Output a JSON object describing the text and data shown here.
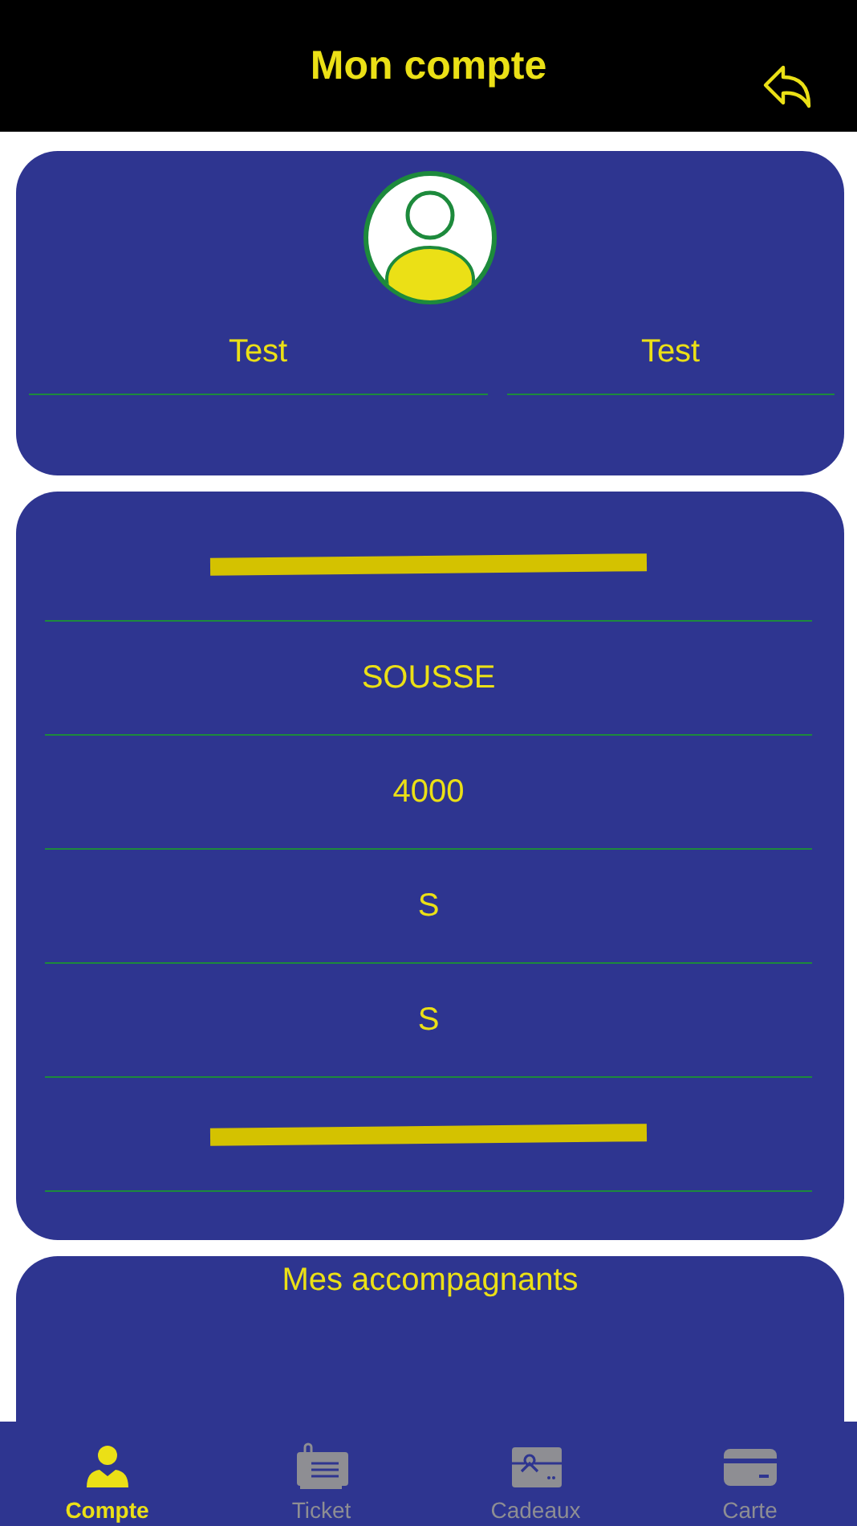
{
  "header": {
    "title": "Mon compte"
  },
  "profile": {
    "names": [
      {
        "value": "Test"
      },
      {
        "value": "Test"
      }
    ]
  },
  "details": [
    {
      "redacted": true
    },
    {
      "value": "SOUSSE",
      "redacted": false
    },
    {
      "value": "4000",
      "redacted": false
    },
    {
      "value": "S",
      "redacted": false
    },
    {
      "value": "S",
      "redacted": false
    },
    {
      "redacted": true
    }
  ],
  "companions": {
    "title": "Mes accompagnants"
  },
  "tabs": [
    {
      "label": "Compte",
      "kind": "user",
      "selected": true
    },
    {
      "label": "Ticket",
      "kind": "ticket",
      "selected": false
    },
    {
      "label": "Cadeaux",
      "kind": "gift",
      "selected": false
    },
    {
      "label": "Carte",
      "kind": "card",
      "selected": false
    }
  ]
}
